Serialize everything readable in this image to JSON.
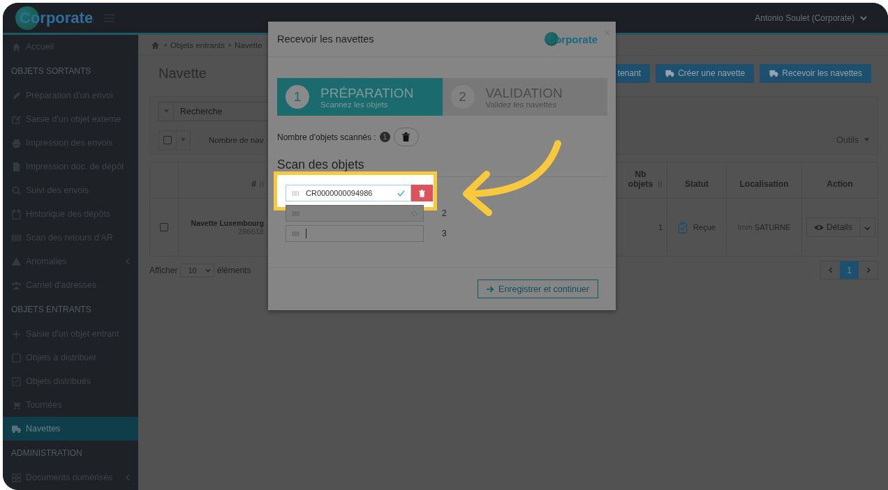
{
  "topbar": {
    "logo": "Corporate",
    "user": "Antonio Soulet (Corporate)"
  },
  "sidebar": [
    {
      "kind": "item",
      "label": "Accueil",
      "selected": false,
      "submenu": false
    },
    {
      "kind": "header",
      "label": "OBJETS SORTANTS"
    },
    {
      "kind": "item",
      "label": "Préparation d'un envoi",
      "selected": false,
      "submenu": false
    },
    {
      "kind": "item",
      "label": "Saisie d'un objet externe",
      "selected": false,
      "submenu": false
    },
    {
      "kind": "item",
      "label": "Impression des envois",
      "selected": false,
      "submenu": false
    },
    {
      "kind": "item",
      "label": "Impression doc. de dépôt",
      "selected": false,
      "submenu": false
    },
    {
      "kind": "item",
      "label": "Suivi des envois",
      "selected": false,
      "submenu": false
    },
    {
      "kind": "item",
      "label": "Historique des dépôts",
      "selected": false,
      "submenu": false
    },
    {
      "kind": "item",
      "label": "Scan des retours d'AR",
      "selected": false,
      "submenu": false
    },
    {
      "kind": "item",
      "label": "Anomalies",
      "selected": false,
      "submenu": true
    },
    {
      "kind": "item",
      "label": "Carnet d'adresses",
      "selected": false,
      "submenu": false
    },
    {
      "kind": "header",
      "label": "OBJETS ENTRANTS"
    },
    {
      "kind": "item",
      "label": "Saisie d'un objet entrant",
      "selected": false,
      "submenu": false
    },
    {
      "kind": "item",
      "label": "Objets à distribuer",
      "selected": false,
      "submenu": false
    },
    {
      "kind": "item",
      "label": "Objets distribués",
      "selected": false,
      "submenu": false
    },
    {
      "kind": "item",
      "label": "Tournées",
      "selected": false,
      "submenu": false
    },
    {
      "kind": "item",
      "label": "Navettes",
      "selected": true,
      "submenu": false
    },
    {
      "kind": "header",
      "label": "ADMINISTRATION"
    },
    {
      "kind": "item",
      "label": "Documents numérisés",
      "selected": false,
      "submenu": true
    }
  ],
  "breadcrumb": [
    "Objets entrants",
    "Navette"
  ],
  "page_title": "Navette",
  "actions": [
    {
      "label": "tenant"
    },
    {
      "label": "Créer une navette"
    },
    {
      "label": "Recevoir les navettes"
    }
  ],
  "filters": {
    "search_placeholder": "Recherche",
    "count_label": "Nombre de nav",
    "tools": "Outils"
  },
  "table": {
    "columns": [
      {
        "label": "#",
        "sortable": true
      },
      {
        "label": "Nb objets",
        "sortable": true
      },
      {
        "label": "Statut",
        "sortable": false
      },
      {
        "label": "Localisation",
        "sortable": false
      },
      {
        "label": "Action",
        "sortable": false
      }
    ],
    "rows": [
      {
        "name": "Navette Luxembourg",
        "id": "286618",
        "count": "1",
        "status": "Reçue",
        "location_prefix": "Imm",
        "location": "SATURNE",
        "action": "Détails",
        "checked": false
      }
    ]
  },
  "footer": {
    "show": "Afficher",
    "page_size": "10",
    "suffix": "éléments",
    "pages": [
      {
        "label": "1",
        "selected": true
      }
    ]
  },
  "modal": {
    "title": "Recevoir les navettes",
    "logo": "Corporate",
    "steps": [
      {
        "number": "1",
        "title": "PRÉPARATION",
        "subtitle": "Scannez les objets",
        "selected": true
      },
      {
        "number": "2",
        "title": "VALIDATION",
        "subtitle": "Validez les navettes",
        "selected": false
      }
    ],
    "count_label": "Nombre d'objets scannés :",
    "count": "1",
    "section": "Scan des objets",
    "scans": [
      {
        "value": "CR0000000094986",
        "kind": "valid",
        "highlighted": true
      },
      {
        "number": "2",
        "kind": "pending",
        "highlighted": false
      },
      {
        "number": "3",
        "kind": "empty",
        "highlighted": false
      }
    ],
    "submit": "Enregistrer et continuer"
  }
}
